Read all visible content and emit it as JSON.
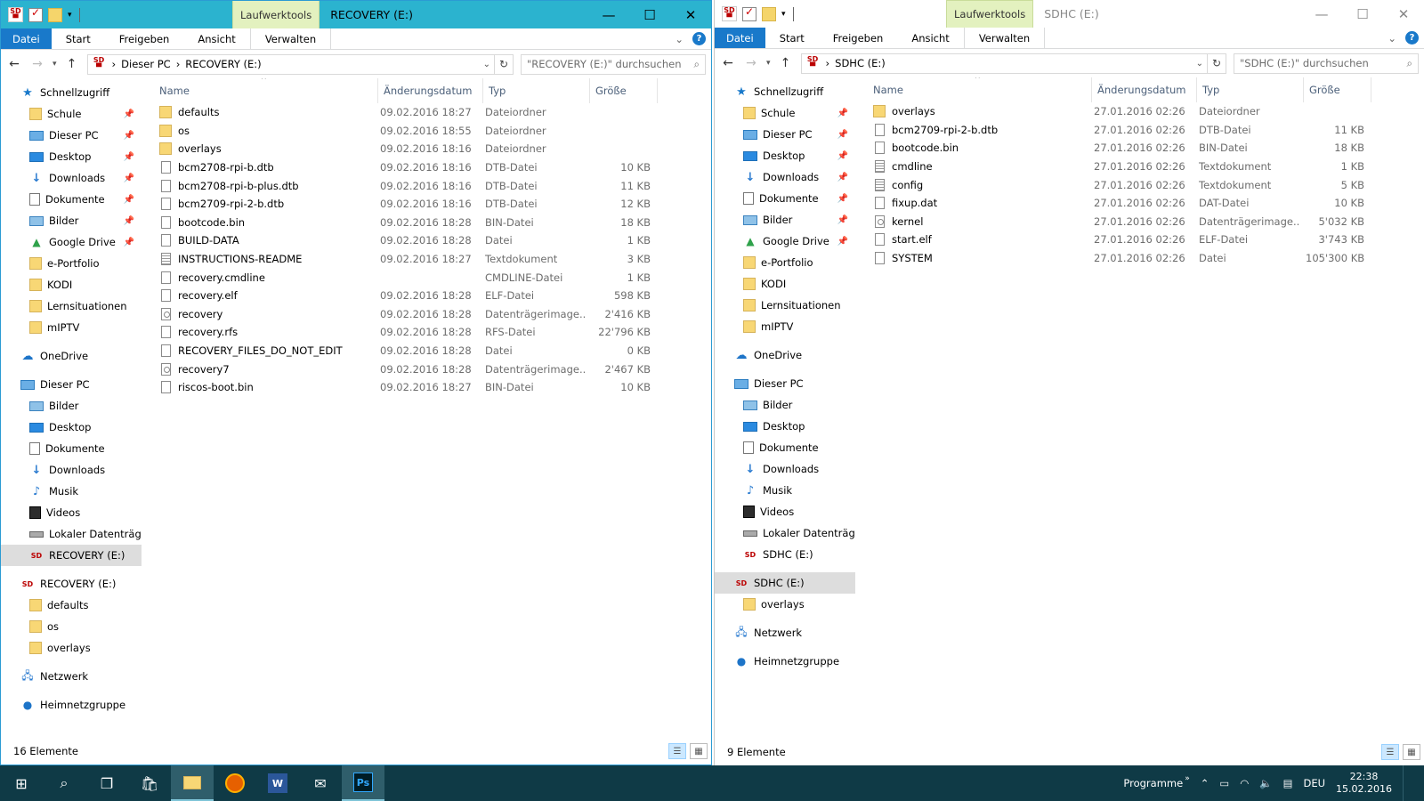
{
  "left": {
    "ctx_tab": "Laufwerktools",
    "title": "RECOVERY (E:)",
    "ribbon_tabs": [
      "Datei",
      "Start",
      "Freigeben",
      "Ansicht",
      "Verwalten"
    ],
    "breadcrumb": [
      "Dieser PC",
      "RECOVERY (E:)"
    ],
    "search_placeholder": "\"RECOVERY (E:)\" durchsuchen",
    "status": "16 Elemente",
    "selected_nav": "RECOVERY (E:)",
    "nav": [
      {
        "label": "Schnellzugriff",
        "icon": "star-icon",
        "level": 0
      },
      {
        "label": "Schule",
        "icon": "folder-icon",
        "level": 1,
        "pinned": true
      },
      {
        "label": "Dieser PC",
        "icon": "pc-icon",
        "level": 1,
        "pinned": true
      },
      {
        "label": "Desktop",
        "icon": "desktop-icon",
        "level": 1,
        "pinned": true
      },
      {
        "label": "Downloads",
        "icon": "downloads-icon",
        "level": 1,
        "pinned": true
      },
      {
        "label": "Dokumente",
        "icon": "documents-icon",
        "level": 1,
        "pinned": true
      },
      {
        "label": "Bilder",
        "icon": "pictures-icon",
        "level": 1,
        "pinned": true
      },
      {
        "label": "Google Drive",
        "icon": "google-drive-icon",
        "level": 1,
        "pinned": true
      },
      {
        "label": "e-Portfolio",
        "icon": "folder-icon",
        "level": 1
      },
      {
        "label": "KODI",
        "icon": "folder-icon",
        "level": 1
      },
      {
        "label": "Lernsituationen",
        "icon": "folder-icon",
        "level": 1
      },
      {
        "label": "mIPTV",
        "icon": "folder-icon",
        "level": 1
      },
      {
        "label": "OneDrive",
        "icon": "onedrive-icon",
        "level": 0,
        "gap": true
      },
      {
        "label": "Dieser PC",
        "icon": "pc-icon",
        "level": 0,
        "gap": true
      },
      {
        "label": "Bilder",
        "icon": "pictures-icon",
        "level": 1
      },
      {
        "label": "Desktop",
        "icon": "desktop-icon",
        "level": 1
      },
      {
        "label": "Dokumente",
        "icon": "documents-icon",
        "level": 1
      },
      {
        "label": "Downloads",
        "icon": "downloads-icon",
        "level": 1
      },
      {
        "label": "Musik",
        "icon": "music-icon",
        "level": 1
      },
      {
        "label": "Videos",
        "icon": "videos-icon",
        "level": 1
      },
      {
        "label": "Lokaler Datenträger",
        "icon": "local-drive-icon",
        "level": 1
      },
      {
        "label": "RECOVERY (E:)",
        "icon": "sd-card-icon",
        "level": 1,
        "selected": true
      },
      {
        "label": "RECOVERY (E:)",
        "icon": "sd-card-icon",
        "level": 0,
        "gap": true
      },
      {
        "label": "defaults",
        "icon": "folder-icon",
        "level": 1
      },
      {
        "label": "os",
        "icon": "folder-icon",
        "level": 1
      },
      {
        "label": "overlays",
        "icon": "folder-icon",
        "level": 1
      },
      {
        "label": "Netzwerk",
        "icon": "network-icon",
        "level": 0,
        "gap": true
      },
      {
        "label": "Heimnetzgruppe",
        "icon": "homegroup-icon",
        "level": 0,
        "gap": true
      }
    ],
    "columns": [
      "Name",
      "Änderungsdatum",
      "Typ",
      "Größe"
    ],
    "files": [
      {
        "name": "defaults",
        "date": "09.02.2016 18:27",
        "type": "Dateiordner",
        "size": "",
        "icon": "folder"
      },
      {
        "name": "os",
        "date": "09.02.2016 18:55",
        "type": "Dateiordner",
        "size": "",
        "icon": "folder"
      },
      {
        "name": "overlays",
        "date": "09.02.2016 18:16",
        "type": "Dateiordner",
        "size": "",
        "icon": "folder"
      },
      {
        "name": "bcm2708-rpi-b.dtb",
        "date": "09.02.2016 18:16",
        "type": "DTB-Datei",
        "size": "10 KB",
        "icon": "file"
      },
      {
        "name": "bcm2708-rpi-b-plus.dtb",
        "date": "09.02.2016 18:16",
        "type": "DTB-Datei",
        "size": "11 KB",
        "icon": "file"
      },
      {
        "name": "bcm2709-rpi-2-b.dtb",
        "date": "09.02.2016 18:16",
        "type": "DTB-Datei",
        "size": "12 KB",
        "icon": "file"
      },
      {
        "name": "bootcode.bin",
        "date": "09.02.2016 18:28",
        "type": "BIN-Datei",
        "size": "18 KB",
        "icon": "file"
      },
      {
        "name": "BUILD-DATA",
        "date": "09.02.2016 18:28",
        "type": "Datei",
        "size": "1 KB",
        "icon": "file"
      },
      {
        "name": "INSTRUCTIONS-README",
        "date": "09.02.2016 18:27",
        "type": "Textdokument",
        "size": "3 KB",
        "icon": "text"
      },
      {
        "name": "recovery.cmdline",
        "date": "",
        "type": "CMDLINE-Datei",
        "size": "1 KB",
        "icon": "file"
      },
      {
        "name": "recovery.elf",
        "date": "09.02.2016 18:28",
        "type": "ELF-Datei",
        "size": "598 KB",
        "icon": "file"
      },
      {
        "name": "recovery",
        "date": "09.02.2016 18:28",
        "type": "Datenträgerimage...",
        "size": "2'416 KB",
        "icon": "image"
      },
      {
        "name": "recovery.rfs",
        "date": "09.02.2016 18:28",
        "type": "RFS-Datei",
        "size": "22'796 KB",
        "icon": "file"
      },
      {
        "name": "RECOVERY_FILES_DO_NOT_EDIT",
        "date": "09.02.2016 18:28",
        "type": "Datei",
        "size": "0 KB",
        "icon": "file"
      },
      {
        "name": "recovery7",
        "date": "09.02.2016 18:28",
        "type": "Datenträgerimage...",
        "size": "2'467 KB",
        "icon": "image"
      },
      {
        "name": "riscos-boot.bin",
        "date": "09.02.2016 18:27",
        "type": "BIN-Datei",
        "size": "10 KB",
        "icon": "file"
      }
    ]
  },
  "right": {
    "ctx_tab": "Laufwerktools",
    "title": "SDHC (E:)",
    "ribbon_tabs": [
      "Datei",
      "Start",
      "Freigeben",
      "Ansicht",
      "Verwalten"
    ],
    "breadcrumb": [
      "SDHC (E:)"
    ],
    "search_placeholder": "\"SDHC (E:)\" durchsuchen",
    "status": "9 Elemente",
    "nav": [
      {
        "label": "Schnellzugriff",
        "icon": "star-icon",
        "level": 0
      },
      {
        "label": "Schule",
        "icon": "folder-icon",
        "level": 1,
        "pinned": true
      },
      {
        "label": "Dieser PC",
        "icon": "pc-icon",
        "level": 1,
        "pinned": true
      },
      {
        "label": "Desktop",
        "icon": "desktop-icon",
        "level": 1,
        "pinned": true
      },
      {
        "label": "Downloads",
        "icon": "downloads-icon",
        "level": 1,
        "pinned": true
      },
      {
        "label": "Dokumente",
        "icon": "documents-icon",
        "level": 1,
        "pinned": true
      },
      {
        "label": "Bilder",
        "icon": "pictures-icon",
        "level": 1,
        "pinned": true
      },
      {
        "label": "Google Drive",
        "icon": "google-drive-icon",
        "level": 1,
        "pinned": true
      },
      {
        "label": "e-Portfolio",
        "icon": "folder-icon",
        "level": 1
      },
      {
        "label": "KODI",
        "icon": "folder-icon",
        "level": 1
      },
      {
        "label": "Lernsituationen",
        "icon": "folder-icon",
        "level": 1
      },
      {
        "label": "mIPTV",
        "icon": "folder-icon",
        "level": 1
      },
      {
        "label": "OneDrive",
        "icon": "onedrive-icon",
        "level": 0,
        "gap": true
      },
      {
        "label": "Dieser PC",
        "icon": "pc-icon",
        "level": 0,
        "gap": true
      },
      {
        "label": "Bilder",
        "icon": "pictures-icon",
        "level": 1
      },
      {
        "label": "Desktop",
        "icon": "desktop-icon",
        "level": 1
      },
      {
        "label": "Dokumente",
        "icon": "documents-icon",
        "level": 1
      },
      {
        "label": "Downloads",
        "icon": "downloads-icon",
        "level": 1
      },
      {
        "label": "Musik",
        "icon": "music-icon",
        "level": 1
      },
      {
        "label": "Videos",
        "icon": "videos-icon",
        "level": 1
      },
      {
        "label": "Lokaler Datenträger",
        "icon": "local-drive-icon",
        "level": 1
      },
      {
        "label": "SDHC (E:)",
        "icon": "sd-card-icon",
        "level": 1
      },
      {
        "label": "SDHC (E:)",
        "icon": "sd-card-icon",
        "level": 0,
        "gap": true,
        "selected": true
      },
      {
        "label": "overlays",
        "icon": "folder-icon",
        "level": 1
      },
      {
        "label": "Netzwerk",
        "icon": "network-icon",
        "level": 0,
        "gap": true
      },
      {
        "label": "Heimnetzgruppe",
        "icon": "homegroup-icon",
        "level": 0,
        "gap": true
      }
    ],
    "columns": [
      "Name",
      "Änderungsdatum",
      "Typ",
      "Größe"
    ],
    "files": [
      {
        "name": "overlays",
        "date": "27.01.2016 02:26",
        "type": "Dateiordner",
        "size": "",
        "icon": "folder"
      },
      {
        "name": "bcm2709-rpi-2-b.dtb",
        "date": "27.01.2016 02:26",
        "type": "DTB-Datei",
        "size": "11 KB",
        "icon": "file"
      },
      {
        "name": "bootcode.bin",
        "date": "27.01.2016 02:26",
        "type": "BIN-Datei",
        "size": "18 KB",
        "icon": "file"
      },
      {
        "name": "cmdline",
        "date": "27.01.2016 02:26",
        "type": "Textdokument",
        "size": "1 KB",
        "icon": "text"
      },
      {
        "name": "config",
        "date": "27.01.2016 02:26",
        "type": "Textdokument",
        "size": "5 KB",
        "icon": "text"
      },
      {
        "name": "fixup.dat",
        "date": "27.01.2016 02:26",
        "type": "DAT-Datei",
        "size": "10 KB",
        "icon": "file"
      },
      {
        "name": "kernel",
        "date": "27.01.2016 02:26",
        "type": "Datenträgerimage...",
        "size": "5'032 KB",
        "icon": "image"
      },
      {
        "name": "start.elf",
        "date": "27.01.2016 02:26",
        "type": "ELF-Datei",
        "size": "3'743 KB",
        "icon": "file"
      },
      {
        "name": "SYSTEM",
        "date": "27.01.2016 02:26",
        "type": "Datei",
        "size": "105'300 KB",
        "icon": "file"
      }
    ]
  },
  "taskbar": {
    "programme_label": "Programme",
    "language": "DEU",
    "time": "22:38",
    "date": "15.02.2016",
    "apps": [
      "start-icon",
      "search-icon",
      "task-view-icon",
      "store-icon",
      "file-explorer-icon",
      "firefox-icon",
      "word-icon",
      "mail-icon",
      "photoshop-icon"
    ]
  },
  "colors": {
    "accent": "#1979ca",
    "titlebar_active": "#2bb3cf",
    "taskbar": "#0f3a46",
    "ctx_tab": "#e3f1bf"
  }
}
